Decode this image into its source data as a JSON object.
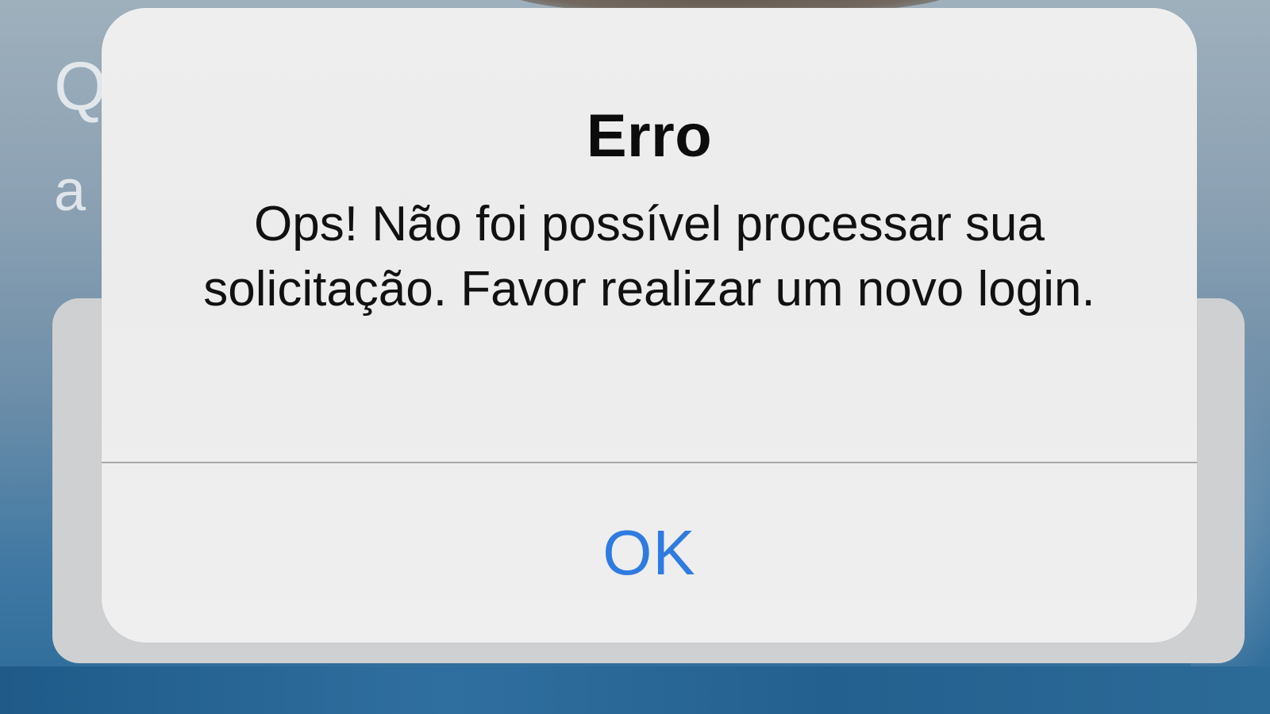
{
  "background": {
    "partial_text_line_1": "Q",
    "partial_text_line_2": "a"
  },
  "alert": {
    "title": "Erro",
    "message": "Ops! Não foi possível processar sua solicitação. Favor realizar um novo login.",
    "button_label": "OK",
    "button_color": "#2f7be0"
  }
}
